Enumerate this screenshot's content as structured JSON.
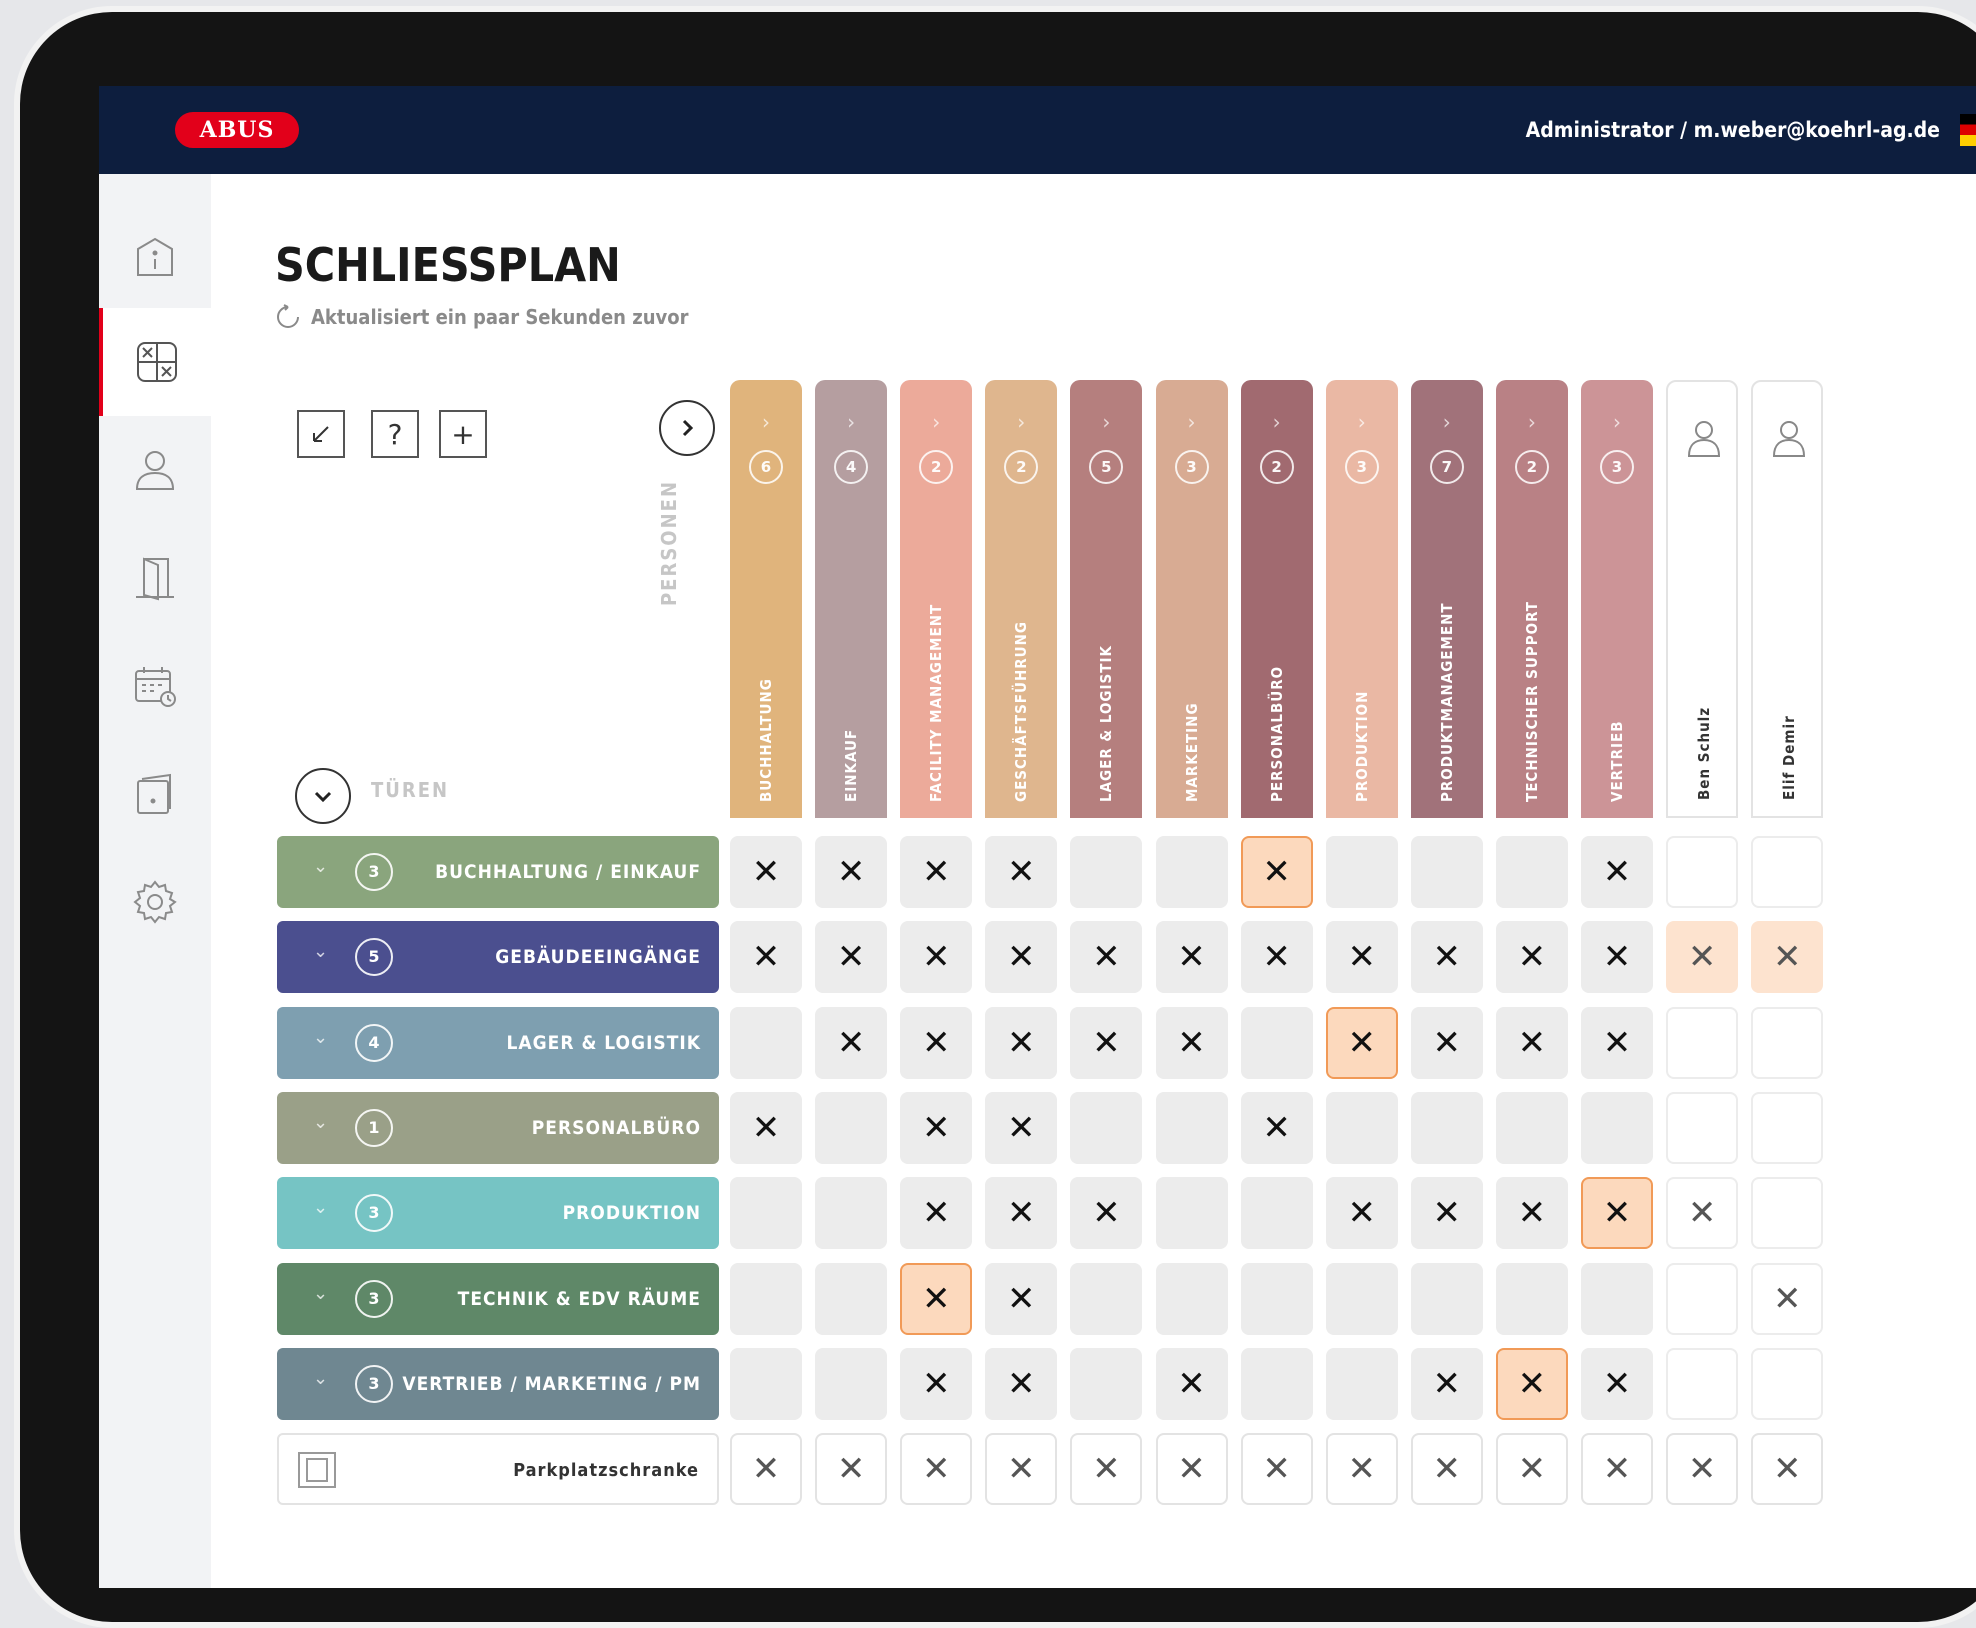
{
  "header": {
    "logo": "ABUS",
    "user": "Administrator / m.weber@koehrl-ag.de"
  },
  "sidebar": {
    "items": [
      {
        "icon": "info-icon"
      },
      {
        "icon": "lock-plan-icon",
        "active": true
      },
      {
        "icon": "user-icon"
      },
      {
        "icon": "door-icon"
      },
      {
        "icon": "calendar-icon"
      },
      {
        "icon": "device-icon"
      },
      {
        "icon": "gear-icon"
      }
    ]
  },
  "page": {
    "title": "SCHLIESSPLAN",
    "updated": "Aktualisiert ein paar Sekunden zuvor"
  },
  "toolbar": {
    "back": "↙",
    "help": "?",
    "add": "+"
  },
  "axis": {
    "persons": "PERSONEN",
    "doors": "TÜREN"
  },
  "columns": [
    {
      "name": "BUCHHALTUNG",
      "count": "6",
      "color": "#e0b47c",
      "type": "group"
    },
    {
      "name": "EINKAUF",
      "count": "4",
      "color": "#b59ea0",
      "type": "group"
    },
    {
      "name": "FACILITY MANAGEMENT",
      "count": "2",
      "color": "#ecaa9a",
      "type": "group"
    },
    {
      "name": "GESCHÄFTSFÜHRUNG",
      "count": "2",
      "color": "#dfb68e",
      "type": "group"
    },
    {
      "name": "LAGER & LOGISTIK",
      "count": "5",
      "color": "#b57f7e",
      "type": "group"
    },
    {
      "name": "MARKETING",
      "count": "3",
      "color": "#d8ab93",
      "type": "group"
    },
    {
      "name": "PERSONALBÜRO",
      "count": "2",
      "color": "#a16a70",
      "type": "group"
    },
    {
      "name": "PRODUKTION",
      "count": "3",
      "color": "#eab8a4",
      "type": "group"
    },
    {
      "name": "PRODUKTMANAGEMENT",
      "count": "7",
      "color": "#a1727a",
      "type": "group"
    },
    {
      "name": "TECHNISCHER SUPPORT",
      "count": "2",
      "color": "#b98185",
      "type": "group"
    },
    {
      "name": "VERTRIEB",
      "count": "3",
      "color": "#cc9497",
      "type": "group"
    },
    {
      "name": "Ben Schulz",
      "type": "person"
    },
    {
      "name": "Elif Demir",
      "type": "person"
    }
  ],
  "rows": [
    {
      "name": "BUCHHALTUNG / EINKAUF",
      "count": "3",
      "color": "#8aa57d",
      "type": "group",
      "cells": [
        "x",
        "x",
        "x",
        "x",
        "",
        "",
        "x!",
        "",
        "",
        "",
        "x",
        "",
        ""
      ]
    },
    {
      "name": "GEBÄUDEEINGÄNGE",
      "count": "5",
      "color": "#4b4f8f",
      "type": "group",
      "cells": [
        "x",
        "x",
        "x",
        "x",
        "x",
        "x",
        "x",
        "x",
        "x",
        "x",
        "x",
        "xs",
        "xs"
      ]
    },
    {
      "name": "LAGER & LOGISTIK",
      "count": "4",
      "color": "#7e9fb0",
      "type": "group",
      "cells": [
        "",
        "x",
        "x",
        "x",
        "x",
        "x",
        "",
        "x!",
        "x",
        "x",
        "x",
        "",
        ""
      ]
    },
    {
      "name": "PERSONALBÜRO",
      "count": "1",
      "color": "#9aa088",
      "type": "group",
      "cells": [
        "x",
        "",
        "x",
        "x",
        "",
        "",
        "x",
        "",
        "",
        "",
        "",
        "",
        ""
      ]
    },
    {
      "name": "PRODUKTION",
      "count": "3",
      "color": "#76c4c4",
      "type": "group",
      "cells": [
        "",
        "",
        "x",
        "x",
        "x",
        "",
        "",
        "x",
        "x",
        "x",
        "x!",
        "xt",
        ""
      ]
    },
    {
      "name": "TECHNIK & EDV RÄUME",
      "count": "3",
      "color": "#5f8868",
      "type": "group",
      "cells": [
        "",
        "",
        "x!",
        "x",
        "",
        "",
        "",
        "",
        "",
        "",
        "",
        "",
        "xt"
      ]
    },
    {
      "name": "VERTRIEB / MARKETING / PM",
      "count": "3",
      "color": "#6f8791",
      "type": "group",
      "cells": [
        "",
        "",
        "x",
        "x",
        "",
        "x",
        "",
        "",
        "x",
        "x!",
        "x",
        "",
        ""
      ]
    },
    {
      "name": "Parkplatzschranke",
      "type": "door",
      "cells": [
        "xt",
        "xt",
        "xt",
        "xt",
        "xt",
        "xt",
        "xt",
        "xt",
        "xt",
        "xt",
        "xt",
        "xt",
        "xt"
      ]
    }
  ],
  "symbols": {
    "cross": "✕"
  },
  "colors": {
    "header_bg": "#0d1e3e",
    "accent": "#e2001a",
    "highlight": "#f19a57"
  }
}
